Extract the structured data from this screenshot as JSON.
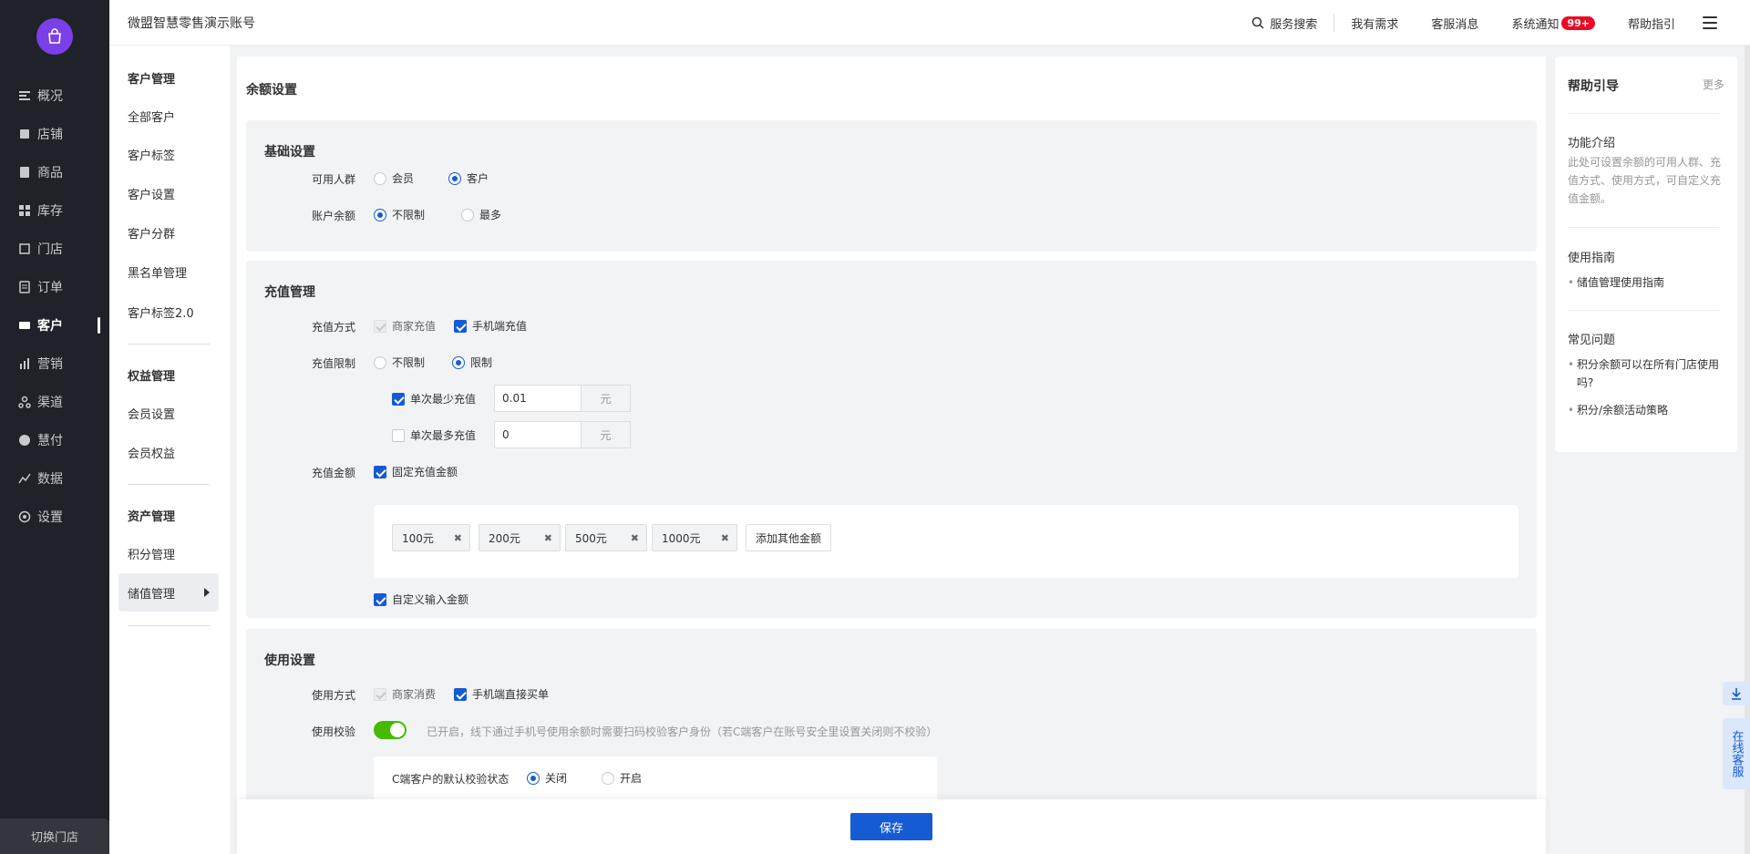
{
  "nav": {
    "items": [
      {
        "label": "概况",
        "icon": "overview-icon"
      },
      {
        "label": "店铺",
        "icon": "shop-icon"
      },
      {
        "label": "商品",
        "icon": "goods-icon"
      },
      {
        "label": "库存",
        "icon": "inventory-icon"
      },
      {
        "label": "门店",
        "icon": "store-icon"
      },
      {
        "label": "订单",
        "icon": "order-icon"
      },
      {
        "label": "客户",
        "icon": "customer-icon"
      },
      {
        "label": "营销",
        "icon": "marketing-icon"
      },
      {
        "label": "渠道",
        "icon": "channel-icon"
      },
      {
        "label": "慧付",
        "icon": "pay-icon"
      },
      {
        "label": "数据",
        "icon": "data-icon"
      },
      {
        "label": "设置",
        "icon": "settings-icon"
      }
    ],
    "active_index": 6,
    "switch_store": "切换门店"
  },
  "subnav": {
    "groups": [
      {
        "title": "客户管理",
        "items": [
          "全部客户",
          "客户标签",
          "客户设置",
          "客户分群",
          "黑名单管理",
          "客户标签2.0"
        ]
      },
      {
        "title": "权益管理",
        "items": [
          "会员设置",
          "会员权益"
        ]
      },
      {
        "title": "资产管理",
        "items": [
          "积分管理",
          "储值管理"
        ]
      }
    ],
    "active_item": "储值管理"
  },
  "topbar": {
    "account": "微盟智慧零售演示账号",
    "search": "服务搜索",
    "demand": "我有需求",
    "service_msg": "客服消息",
    "notice": "系统通知",
    "notice_badge": "99+",
    "help": "帮助指引"
  },
  "main": {
    "title": "余额设置",
    "basic": {
      "title": "基础设置",
      "audience_label": "可用人群",
      "audience_options": [
        "会员",
        "客户"
      ],
      "audience_selected": "客户",
      "balance_label": "账户余额",
      "balance_options": [
        "不限制",
        "最多"
      ],
      "balance_selected": "不限制"
    },
    "recharge": {
      "title": "充值管理",
      "method_label": "充值方式",
      "method_options": [
        {
          "label": "商家充值",
          "state": "disabled-checked"
        },
        {
          "label": "手机端充值",
          "state": "checked"
        }
      ],
      "limit_label": "充值限制",
      "limit_options": [
        "不限制",
        "限制"
      ],
      "limit_selected": "限制",
      "min_label": "单次最少充值",
      "min_checked": true,
      "min_value": "0.01",
      "max_label": "单次最多充值",
      "max_checked": false,
      "max_value": "0",
      "unit": "元",
      "amount_label": "充值金额",
      "fixed_label": "固定充值金额",
      "amounts": [
        "100元",
        "200元",
        "500元",
        "1000元"
      ],
      "add_amount": "添加其他金额",
      "custom_label": "自定义输入金额"
    },
    "usage": {
      "title": "使用设置",
      "method_label": "使用方式",
      "method_options": [
        {
          "label": "商家消费",
          "state": "disabled-checked"
        },
        {
          "label": "手机端直接买单",
          "state": "checked"
        }
      ],
      "verify_label": "使用校验",
      "verify_on": true,
      "verify_hint": "已开启，线下通过手机号使用余额时需要扫码校验客户身份（若C端客户在账号安全里设置关闭则不校验）",
      "default_label": "C端客户的默认校验状态",
      "default_options": [
        "关闭",
        "开启"
      ],
      "default_selected": "关闭"
    },
    "save": "保存"
  },
  "help": {
    "title": "帮助引导",
    "more": "更多",
    "intro_title": "功能介绍",
    "intro_text": "此处可设置余额的可用人群、充值方式、使用方式，可自定义充值金额。",
    "guide_title": "使用指南",
    "guide_items": [
      "储值管理使用指南"
    ],
    "faq_title": "常见问题",
    "faq_items": [
      "积分余额可以在所有门店使用吗?",
      "积分/余额活动策略"
    ]
  },
  "float": {
    "customer_service": "在线客服"
  },
  "colors": {
    "primary": "#155bd4",
    "nav_bg": "#1f2228",
    "switch_on": "#44bb00",
    "badge": "#ee0a24"
  }
}
